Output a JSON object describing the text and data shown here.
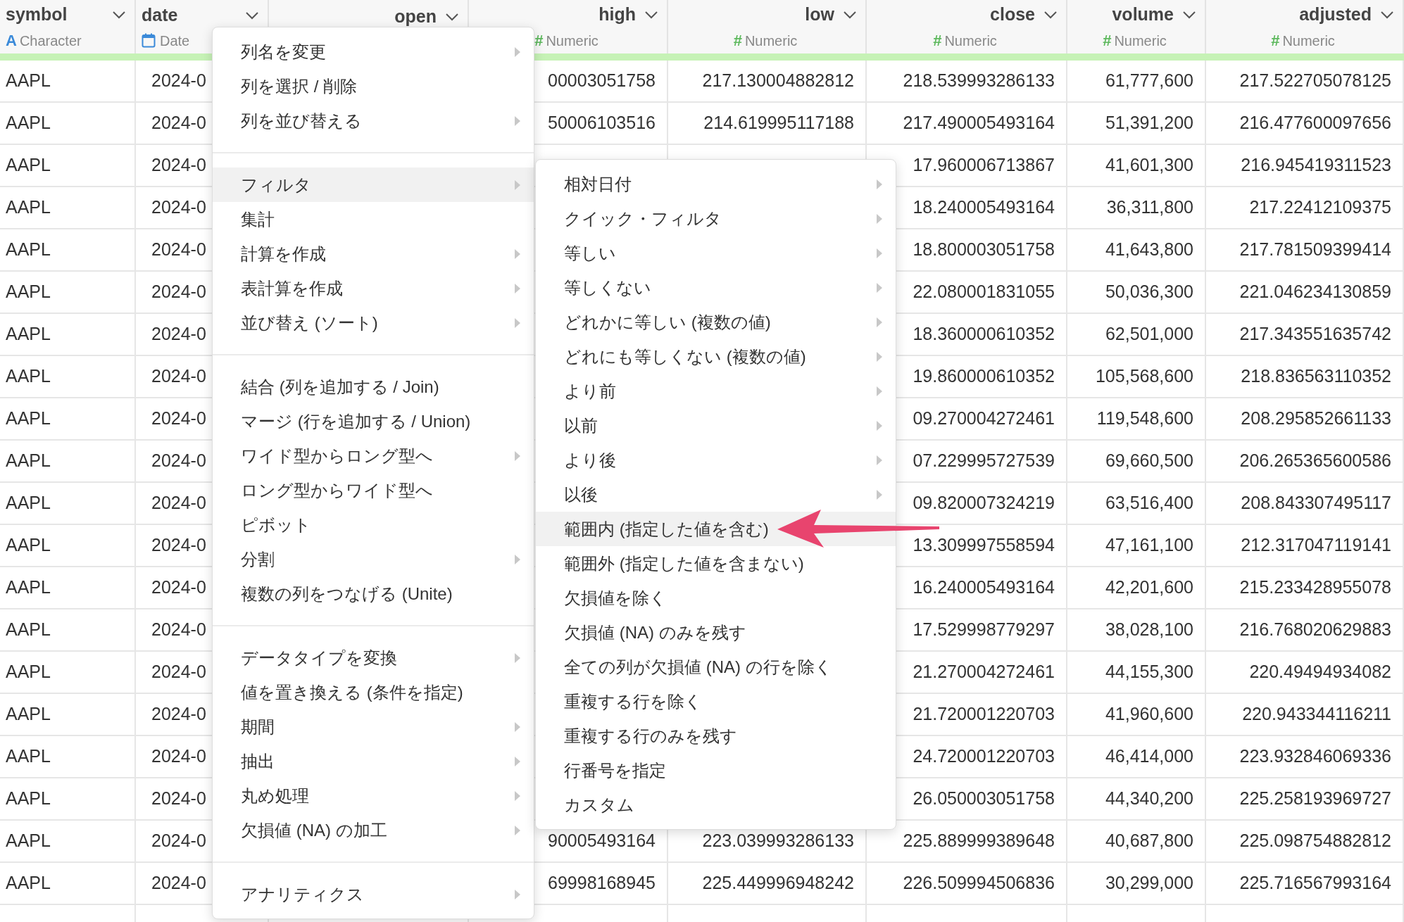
{
  "columns": [
    {
      "name": "symbol",
      "kind": "character",
      "type_glyph": "A",
      "type_label": "Character"
    },
    {
      "name": "date",
      "kind": "date",
      "type_label": "Date"
    },
    {
      "name": "open"
    },
    {
      "name": "high",
      "kind": "numeric",
      "type_glyph": "#",
      "type_label": "Numeric"
    },
    {
      "name": "low",
      "kind": "numeric",
      "type_glyph": "#",
      "type_label": "Numeric"
    },
    {
      "name": "close",
      "kind": "numeric",
      "type_glyph": "#",
      "type_label": "Numeric"
    },
    {
      "name": "volume",
      "kind": "numeric",
      "type_glyph": "#",
      "type_label": "Numeric"
    },
    {
      "name": "adjusted",
      "kind": "numeric",
      "type_glyph": "#",
      "type_label": "Numeric"
    }
  ],
  "rows": [
    [
      "AAPL",
      "2024-0",
      null,
      "00003051758",
      "217.130004882812",
      "218.539993286133",
      "61,777,600",
      "217.522705078125"
    ],
    [
      "AAPL",
      "2024-0",
      null,
      "50006103516",
      "214.619995117188",
      "217.490005493164",
      "51,391,200",
      "216.477600097656"
    ],
    [
      "AAPL",
      "2024-0",
      null,
      null,
      null,
      "17.960006713867",
      "41,601,300",
      "216.945419311523"
    ],
    [
      "AAPL",
      "2024-0",
      null,
      null,
      null,
      "18.240005493164",
      "36,311,800",
      "217.22412109375"
    ],
    [
      "AAPL",
      "2024-0",
      null,
      null,
      null,
      "18.800003051758",
      "41,643,800",
      "217.781509399414"
    ],
    [
      "AAPL",
      "2024-0",
      null,
      null,
      null,
      "22.080001831055",
      "50,036,300",
      "221.046234130859"
    ],
    [
      "AAPL",
      "2024-0",
      null,
      null,
      null,
      "18.360000610352",
      "62,501,000",
      "217.343551635742"
    ],
    [
      "AAPL",
      "2024-0",
      null,
      null,
      null,
      "19.860000610352",
      "105,568,600",
      "218.836563110352"
    ],
    [
      "AAPL",
      "2024-0",
      null,
      null,
      null,
      "09.270004272461",
      "119,548,600",
      "208.295852661133"
    ],
    [
      "AAPL",
      "2024-0",
      null,
      null,
      null,
      "07.229995727539",
      "69,660,500",
      "206.265365600586"
    ],
    [
      "AAPL",
      "2024-0",
      null,
      null,
      null,
      "09.820007324219",
      "63,516,400",
      "208.843307495117"
    ],
    [
      "AAPL",
      "2024-0",
      null,
      null,
      null,
      "13.309997558594",
      "47,161,100",
      "212.317047119141"
    ],
    [
      "AAPL",
      "2024-0",
      null,
      null,
      null,
      "16.240005493164",
      "42,201,600",
      "215.233428955078"
    ],
    [
      "AAPL",
      "2024-0",
      null,
      null,
      null,
      "17.529998779297",
      "38,028,100",
      "216.768020629883"
    ],
    [
      "AAPL",
      "2024-0",
      null,
      null,
      null,
      "21.270004272461",
      "44,155,300",
      "220.49494934082"
    ],
    [
      "AAPL",
      "2024-0",
      null,
      null,
      null,
      "21.720001220703",
      "41,960,600",
      "220.943344116211"
    ],
    [
      "AAPL",
      "2024-0",
      null,
      null,
      null,
      "24.720001220703",
      "46,414,000",
      "223.932846069336"
    ],
    [
      "AAPL",
      "2024-0",
      null,
      null,
      null,
      "26.050003051758",
      "44,340,200",
      "225.258193969727"
    ],
    [
      "AAPL",
      "2024-0",
      null,
      "90005493164",
      "223.039993286133",
      "225.889999389648",
      "40,687,800",
      "225.098754882812"
    ],
    [
      "AAPL",
      "2024-0",
      null,
      "69998168945",
      "225.449996948242",
      "226.509994506836",
      "30,299,000",
      "225.716567993164"
    ]
  ],
  "column_menu": {
    "sections": [
      {
        "items": [
          {
            "label": "列名を変更",
            "has_submenu": true,
            "selected": false
          },
          {
            "label": "列を選択 / 削除",
            "has_submenu": false,
            "selected": false
          },
          {
            "label": "列を並び替える",
            "has_submenu": true,
            "selected": false
          }
        ]
      },
      {
        "items": [
          {
            "label": "フィルタ",
            "has_submenu": true,
            "selected": true
          },
          {
            "label": "集計",
            "has_submenu": false,
            "selected": false
          },
          {
            "label": "計算を作成",
            "has_submenu": true,
            "selected": false
          },
          {
            "label": "表計算を作成",
            "has_submenu": true,
            "selected": false
          },
          {
            "label": "並び替え (ソート)",
            "has_submenu": true,
            "selected": false
          }
        ]
      },
      {
        "items": [
          {
            "label": "結合 (列を追加する / Join)",
            "has_submenu": false,
            "selected": false
          },
          {
            "label": "マージ (行を追加する / Union)",
            "has_submenu": false,
            "selected": false
          },
          {
            "label": "ワイド型からロング型へ",
            "has_submenu": true,
            "selected": false
          },
          {
            "label": "ロング型からワイド型へ",
            "has_submenu": false,
            "selected": false
          },
          {
            "label": "ピボット",
            "has_submenu": false,
            "selected": false
          },
          {
            "label": "分割",
            "has_submenu": true,
            "selected": false
          },
          {
            "label": "複数の列をつなげる (Unite)",
            "has_submenu": false,
            "selected": false
          }
        ]
      },
      {
        "items": [
          {
            "label": "データタイプを変換",
            "has_submenu": true,
            "selected": false
          },
          {
            "label": "値を置き換える (条件を指定)",
            "has_submenu": false,
            "selected": false
          },
          {
            "label": "期間",
            "has_submenu": true,
            "selected": false
          },
          {
            "label": "抽出",
            "has_submenu": true,
            "selected": false
          },
          {
            "label": "丸め処理",
            "has_submenu": true,
            "selected": false
          },
          {
            "label": "欠損値 (NA) の加工",
            "has_submenu": true,
            "selected": false
          }
        ]
      },
      {
        "items": [
          {
            "label": "アナリティクス",
            "has_submenu": true,
            "selected": false
          }
        ]
      }
    ]
  },
  "filter_submenu": {
    "items": [
      {
        "label": "相対日付",
        "has_submenu": true,
        "selected": false
      },
      {
        "label": "クイック・フィルタ",
        "has_submenu": true,
        "selected": false
      },
      {
        "label": "等しい",
        "has_submenu": true,
        "selected": false
      },
      {
        "label": "等しくない",
        "has_submenu": true,
        "selected": false
      },
      {
        "label": "どれかに等しい (複数の値)",
        "has_submenu": true,
        "selected": false
      },
      {
        "label": "どれにも等しくない (複数の値)",
        "has_submenu": true,
        "selected": false
      },
      {
        "label": "より前",
        "has_submenu": true,
        "selected": false
      },
      {
        "label": "以前",
        "has_submenu": true,
        "selected": false
      },
      {
        "label": "より後",
        "has_submenu": true,
        "selected": false
      },
      {
        "label": "以後",
        "has_submenu": true,
        "selected": false
      },
      {
        "label": "範囲内 (指定した値を含む)",
        "has_submenu": false,
        "selected": true
      },
      {
        "label": "範囲外 (指定した値を含まない)",
        "has_submenu": false,
        "selected": false
      },
      {
        "label": "欠損値を除く",
        "has_submenu": false,
        "selected": false
      },
      {
        "label": "欠損値 (NA) のみを残す",
        "has_submenu": false,
        "selected": false
      },
      {
        "label": "全ての列が欠損値 (NA) の行を除く",
        "has_submenu": false,
        "selected": false
      },
      {
        "label": "重複する行を除く",
        "has_submenu": false,
        "selected": false
      },
      {
        "label": "重複する行のみを残す",
        "has_submenu": false,
        "selected": false
      },
      {
        "label": "行番号を指定",
        "has_submenu": false,
        "selected": false
      },
      {
        "label": "カスタム",
        "has_submenu": false,
        "selected": false
      }
    ]
  }
}
